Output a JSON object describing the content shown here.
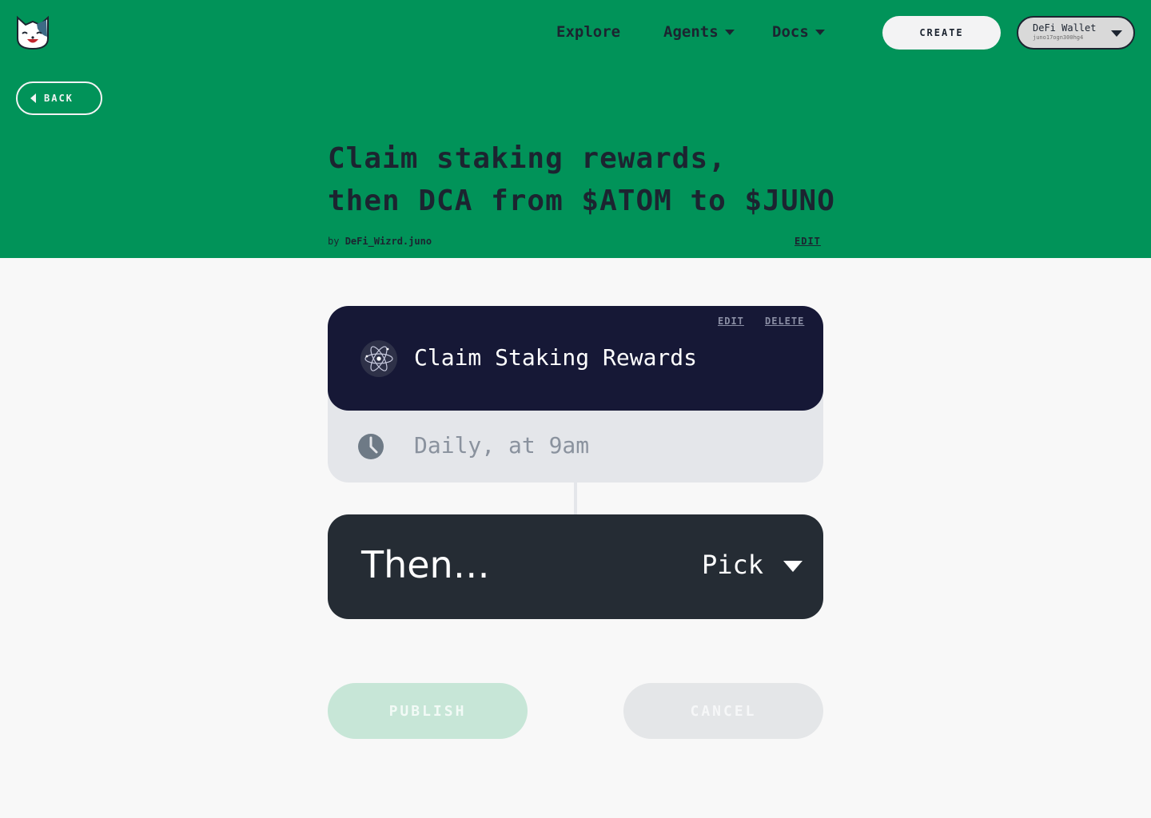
{
  "nav": {
    "explore": "Explore",
    "agents": "Agents",
    "docs": "Docs",
    "create": "CREATE",
    "wallet_name": "DeFi Wallet",
    "wallet_address": "juno17ogn300hg4"
  },
  "back": "BACK",
  "recipe": {
    "title_line1": "Claim staking rewards,",
    "title_line2": "then DCA from $ATOM to $JUNO",
    "by_prefix": "by",
    "author": "DeFi_Wizrd.juno",
    "edit": "EDIT"
  },
  "trigger": {
    "edit": "EDIT",
    "delete": "DELETE",
    "title": "Claim Staking Rewards",
    "schedule": "Daily, at 9am"
  },
  "next_step": {
    "label": "Then…",
    "picker": "Pick"
  },
  "actions": {
    "publish": "PUBLISH",
    "cancel": "CANCEL"
  },
  "colors": {
    "hero_green": "#019359",
    "trigger_navy": "#161836",
    "then_dark": "#252c34"
  }
}
